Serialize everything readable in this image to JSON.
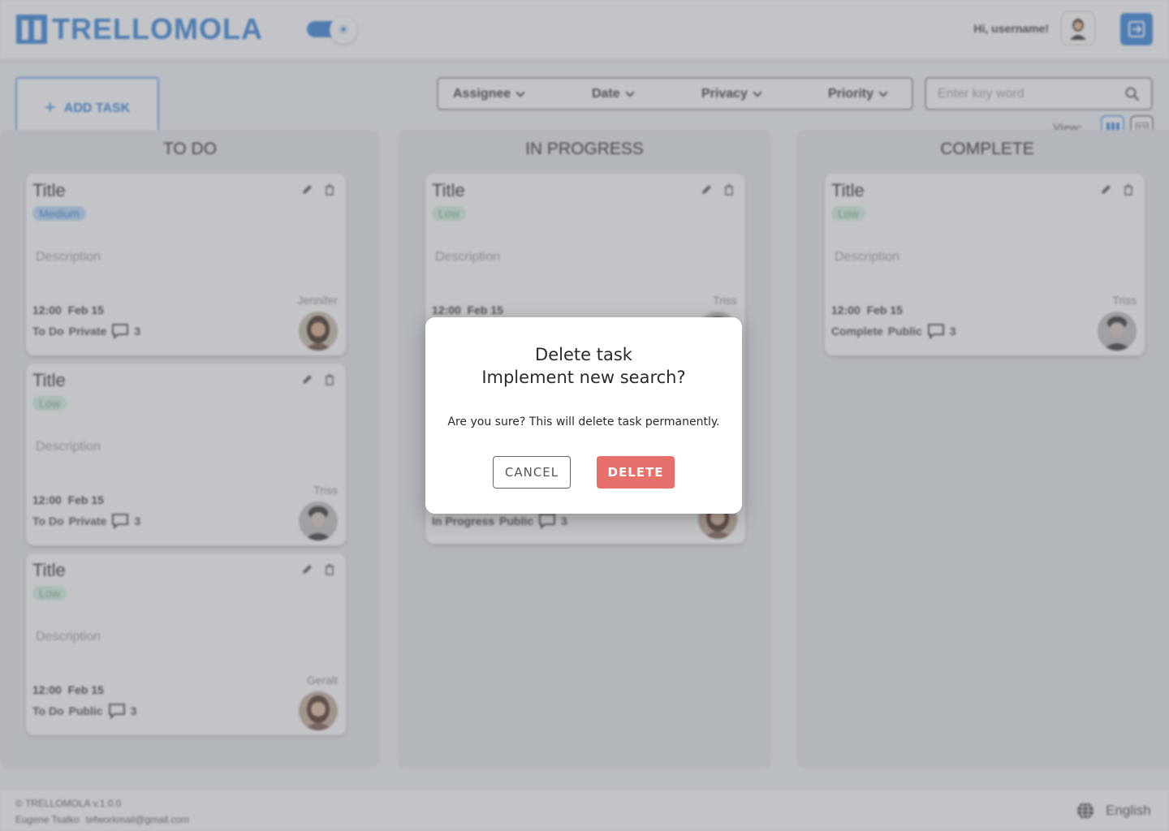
{
  "header": {
    "logo_text": "TRELLOMOLA",
    "greeting": "Hi, username!",
    "theme_toggle": "theme-toggle",
    "logout_icon": "logout-icon"
  },
  "toolbar": {
    "add_task_label": "ADD TASK",
    "filters": [
      "Assignee",
      "Date",
      "Privacy",
      "Priority"
    ],
    "search_placeholder": "Enter key word",
    "view_label": "View:"
  },
  "columns": [
    {
      "title": "TO DO",
      "cards": [
        {
          "title": "Title",
          "priority": "Medium",
          "description": "Description",
          "time": "12:00",
          "date": "Feb 15",
          "status": "To Do",
          "privacy": "Private",
          "comments": "3",
          "assignee": "Jennifer"
        },
        {
          "title": "Title",
          "priority": "Low",
          "description": "Description",
          "time": "12:00",
          "date": "Feb 15",
          "status": "To Do",
          "privacy": "Private",
          "comments": "3",
          "assignee": "Triss"
        },
        {
          "title": "Title",
          "priority": "Low",
          "description": "Description",
          "time": "12:00",
          "date": "Feb 15",
          "status": "To Do",
          "privacy": "Public",
          "comments": "3",
          "assignee": "Geralt"
        }
      ]
    },
    {
      "title": "IN PROGRESS",
      "cards": [
        {
          "title": "Title",
          "priority": "Low",
          "description": "Description",
          "time": "12:00",
          "date": "Feb 15",
          "assignee": "Triss"
        },
        {
          "status": "In Progress",
          "privacy": "Public",
          "comments": "3"
        }
      ]
    },
    {
      "title": "COMPLETE",
      "cards": [
        {
          "title": "Title",
          "priority": "Low",
          "description": "Description",
          "time": "12:00",
          "date": "Feb 15",
          "status": "Complete",
          "privacy": "Public",
          "comments": "3",
          "assignee": "Triss"
        }
      ]
    }
  ],
  "footer": {
    "copyright": "© TRELLOMOLA  v.1.0.0",
    "author": "Eugene Tsalko",
    "email": "tefworkmail@gmail.com",
    "language": "English"
  },
  "modal": {
    "title_line1": "Delete  task",
    "title_line2": "Implement new search?",
    "message": "Are you sure? This will delete task permanently.",
    "cancel_label": "CANCEL",
    "delete_label": "DELETE"
  },
  "colors": {
    "brand": "#2f7fd8",
    "danger": "#e8706b",
    "medium_badge": "#b9d8f7",
    "low_badge": "#d7f0de"
  }
}
